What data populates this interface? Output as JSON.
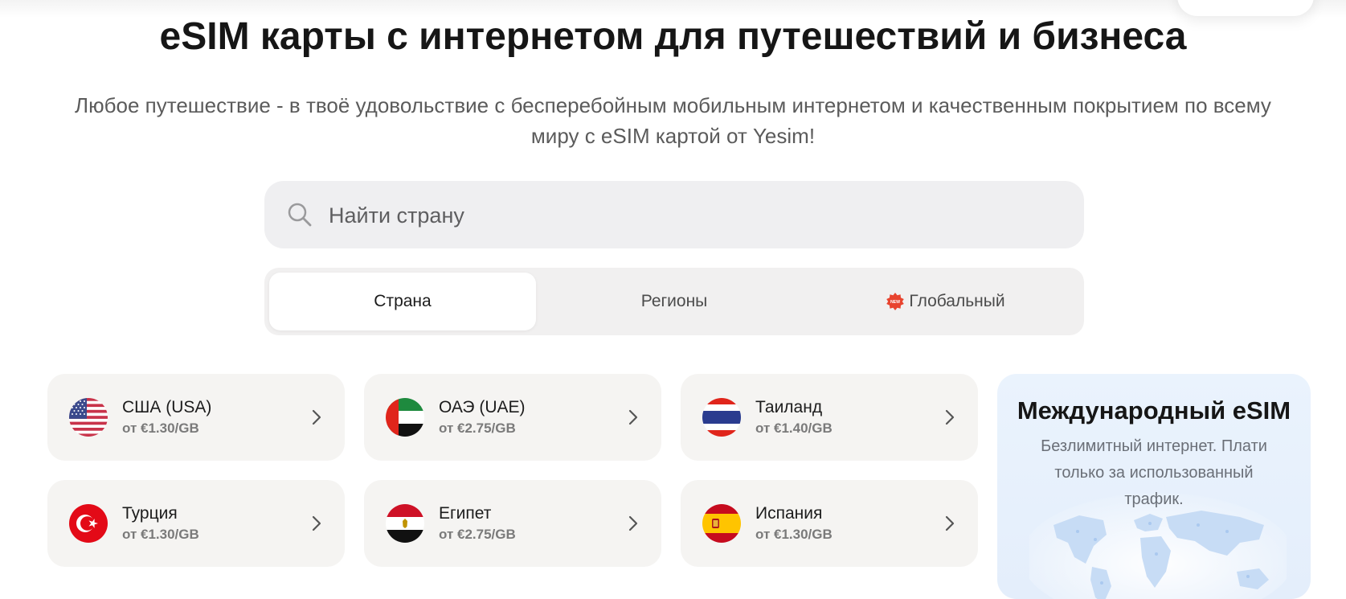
{
  "header": {
    "title": "eSIM карты с интернетом для путешествий и бизнеса",
    "subtitle": "Любое путешествие - в твоё удовольствие с бесперебойным мобильным интернетом и качественным покрытием по всему миру с eSIM картой от Yesim!"
  },
  "search": {
    "placeholder": "Найти страну",
    "value": "",
    "icon": "search-icon"
  },
  "tabs": [
    {
      "label": "Страна",
      "active": true
    },
    {
      "label": "Регионы",
      "active": false
    },
    {
      "label": "Глобальный",
      "active": false,
      "badge": "NEW"
    }
  ],
  "countries": [
    {
      "name": "США (USA)",
      "price": "от €1.30/GB",
      "flag": "us-flag-icon"
    },
    {
      "name": "ОАЭ (UAE)",
      "price": "от €2.75/GB",
      "flag": "uae-flag-icon"
    },
    {
      "name": "Таиланд",
      "price": "от €1.40/GB",
      "flag": "thailand-flag-icon"
    },
    {
      "name": "Турция",
      "price": "от €1.30/GB",
      "flag": "turkey-flag-icon"
    },
    {
      "name": "Египет",
      "price": "от €2.75/GB",
      "flag": "egypt-flag-icon"
    },
    {
      "name": "Испания",
      "price": "от €1.30/GB",
      "flag": "spain-flag-icon"
    }
  ],
  "international": {
    "title": "Международный eSIM",
    "description": "Безлимитный интернет. Плати только за использованный трафик."
  },
  "colors": {
    "search_bg": "#efeff1",
    "tabs_bg": "#f1f0f0",
    "card_bg": "#f5f4f2",
    "intl_bg": "#eaf3fd",
    "badge_red": "#e8442f"
  }
}
